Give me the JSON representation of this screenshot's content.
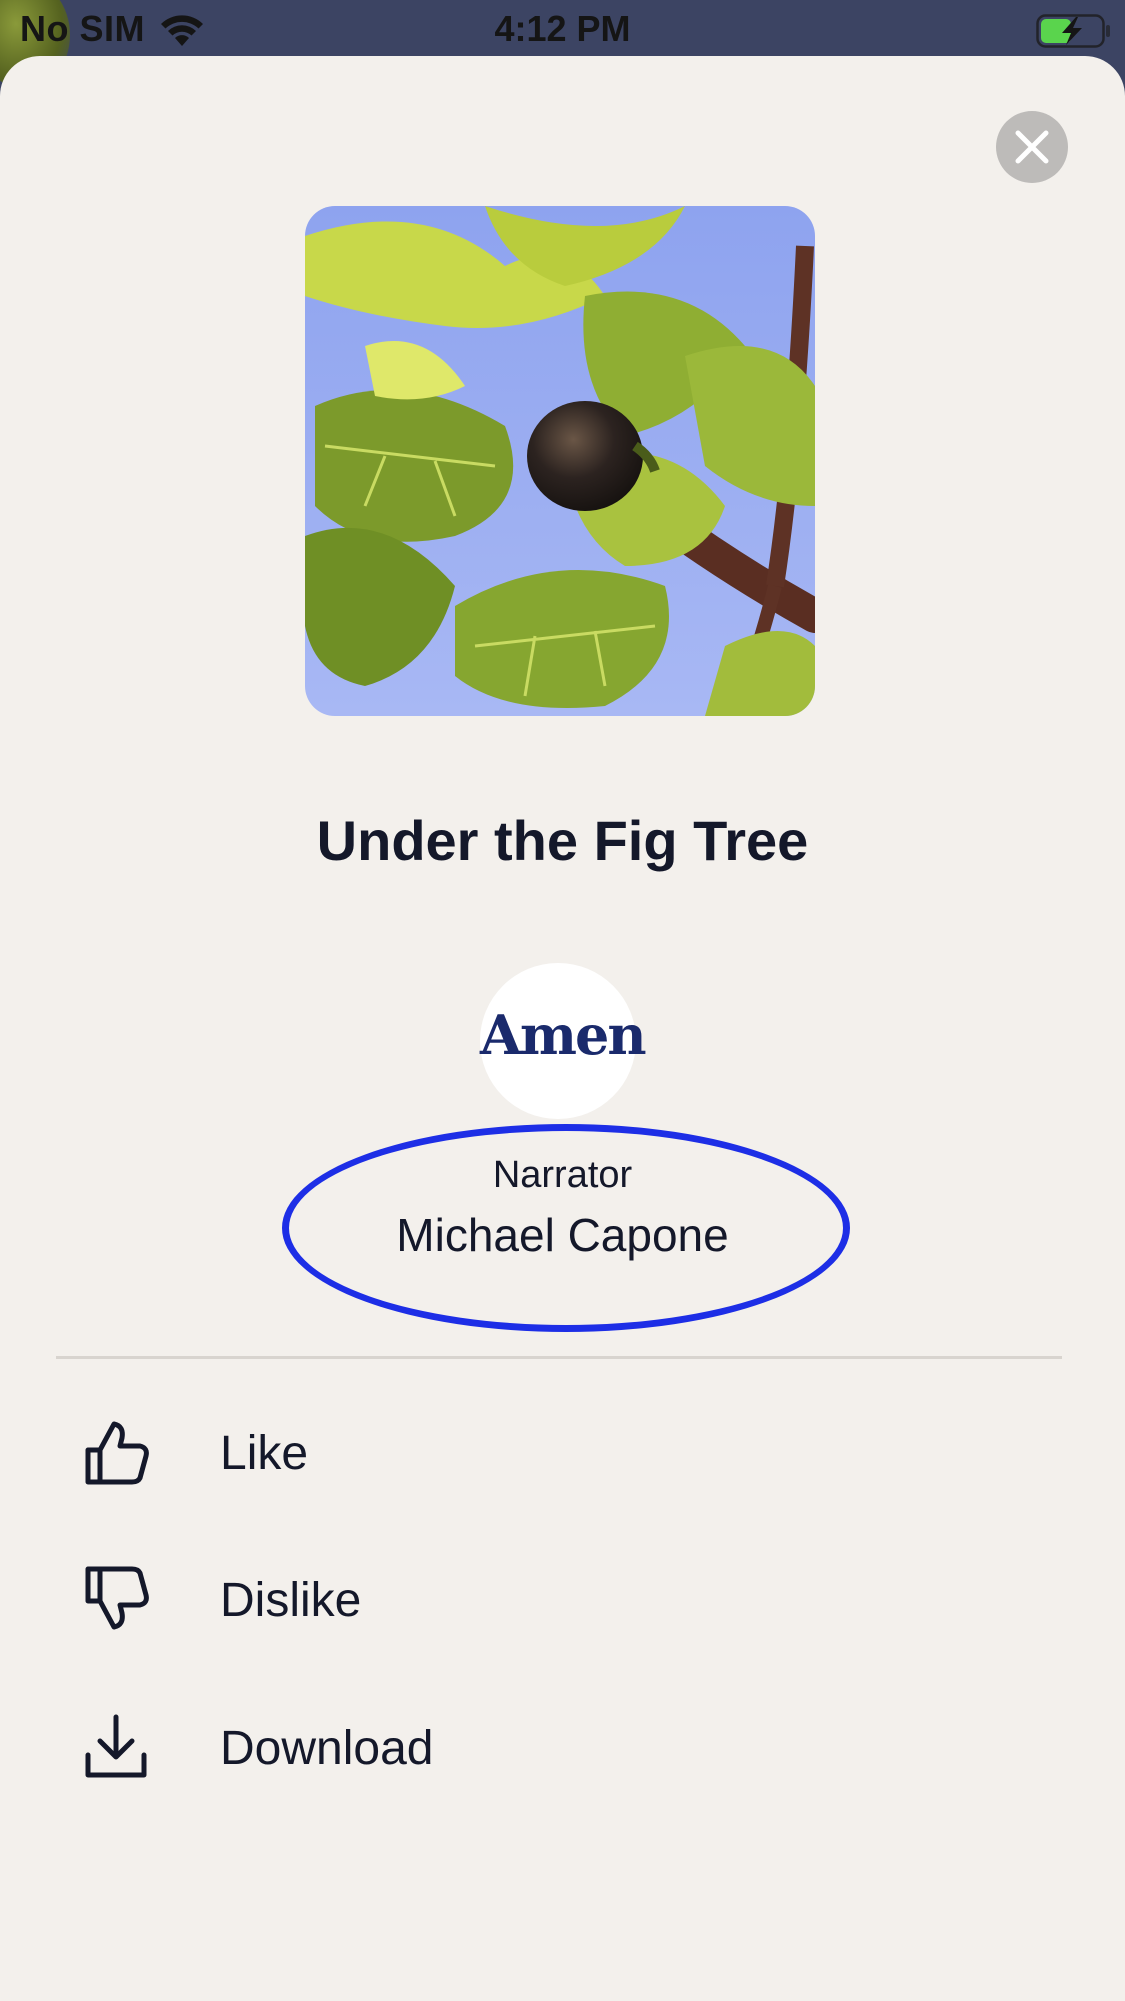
{
  "status_bar": {
    "carrier": "No SIM",
    "time": "4:12 PM"
  },
  "sheet": {
    "title": "Under the Fig Tree",
    "cover_image": "fig-tree-photo",
    "publisher_logo": "Amen",
    "narrator": {
      "role": "Narrator",
      "name": "Michael Capone"
    },
    "actions": [
      {
        "label": "Like",
        "icon": "thumbs-up-icon"
      },
      {
        "label": "Dislike",
        "icon": "thumbs-down-icon"
      },
      {
        "label": "Download",
        "icon": "download-icon"
      }
    ]
  },
  "colors": {
    "sheet_background": "#f3f0ec",
    "text": "#14182a",
    "highlight_ellipse": "#1d2ee6",
    "close_button": "#bdbbb9",
    "battery_charge": "#5ad44d"
  }
}
